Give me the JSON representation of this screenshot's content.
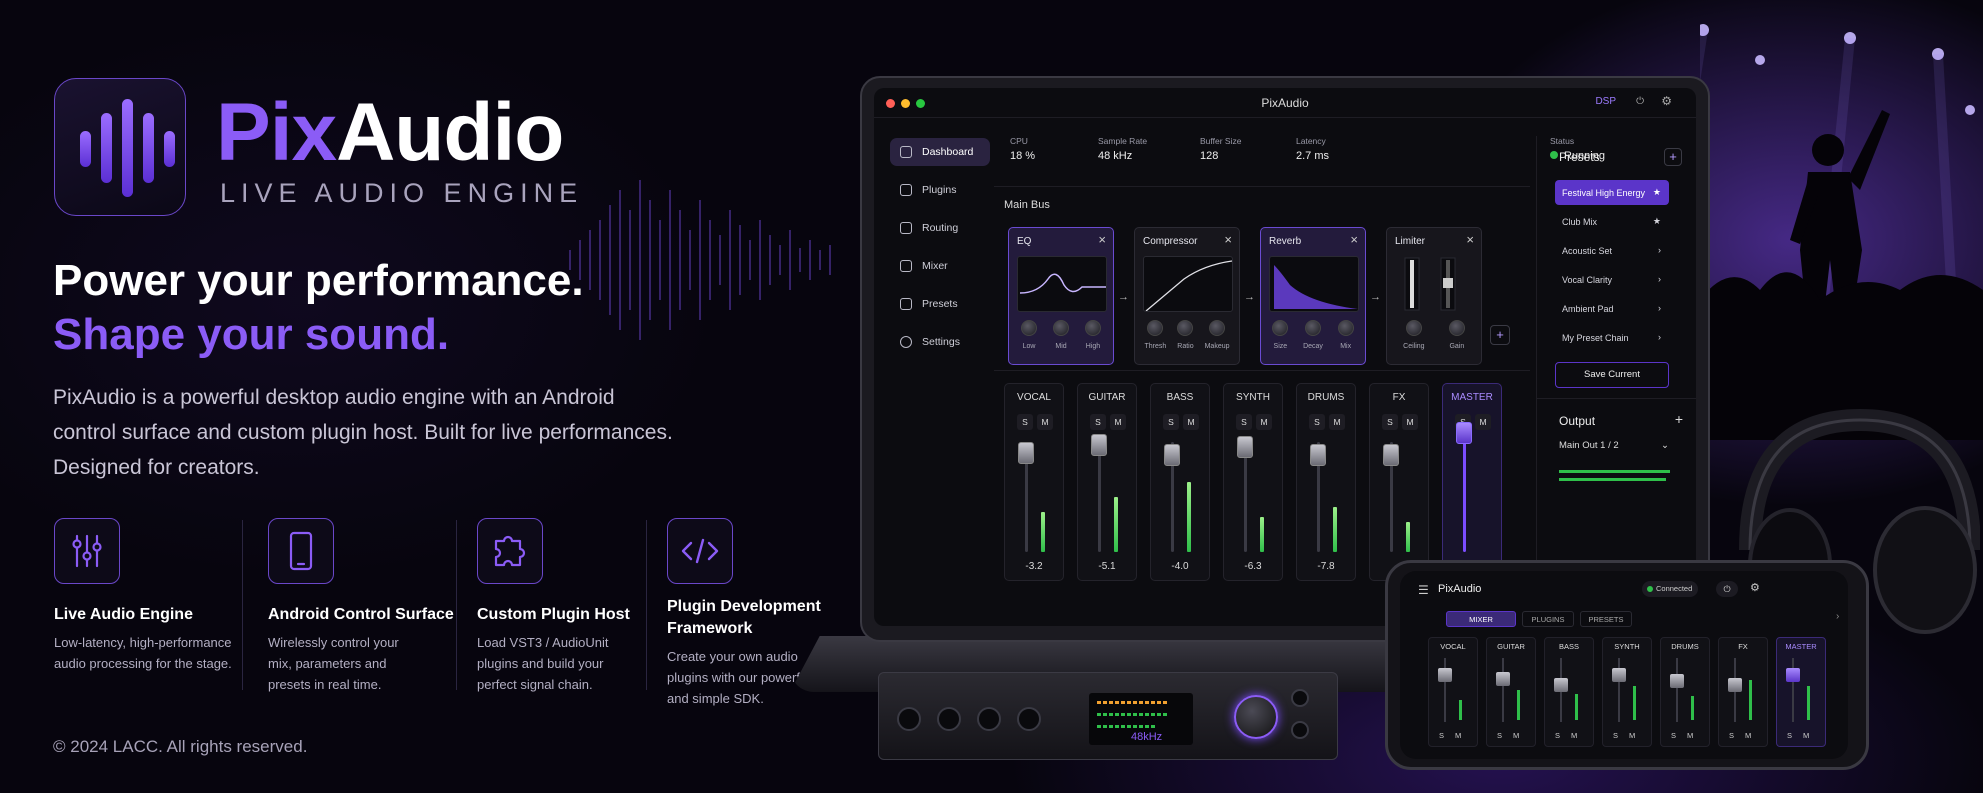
{
  "brand": {
    "name_a": "Pix",
    "name_b": "Audio",
    "tagline": "LIVE AUDIO ENGINE"
  },
  "hero": {
    "line1": "Power your performance.",
    "line2": "Shape your sound.",
    "description": "PixAudio is a powerful desktop audio engine with an Android control surface and custom plugin host. Built for live performances. Designed for creators."
  },
  "features": [
    {
      "icon": "sliders-icon",
      "title": "Live Audio Engine",
      "desc": "Low-latency, high-performance audio processing for the stage."
    },
    {
      "icon": "smartphone-icon",
      "title": "Android Control Surface",
      "desc": "Wirelessly control your mix, parameters and presets in real time."
    },
    {
      "icon": "puzzle-icon",
      "title": "Custom Plugin Host",
      "desc": "Load VST3 / AudioUnit plugins and build your perfect signal chain."
    },
    {
      "icon": "code-icon",
      "title": "Plugin Development Framework",
      "desc": "Create your own audio plugins with our powerful and simple SDK."
    }
  ],
  "footer": {
    "copyright": "© 2024 LACC. All rights reserved."
  },
  "app": {
    "title": "PixAudio",
    "dsp": "DSP",
    "sidebar": [
      {
        "label": "Dashboard",
        "icon": "dashboard-icon",
        "active": true
      },
      {
        "label": "Plugins",
        "icon": "plugin-icon"
      },
      {
        "label": "Routing",
        "icon": "routing-icon"
      },
      {
        "label": "Mixer",
        "icon": "mixer-icon"
      },
      {
        "label": "Presets",
        "icon": "preset-icon"
      },
      {
        "label": "Settings",
        "icon": "gear-icon"
      }
    ],
    "stats": [
      {
        "label": "CPU",
        "value": "18 %"
      },
      {
        "label": "Sample Rate",
        "value": "48 kHz"
      },
      {
        "label": "Buffer Size",
        "value": "128"
      },
      {
        "label": "Latency",
        "value": "2.7 ms"
      }
    ],
    "status": {
      "label": "Status",
      "value": "Running"
    },
    "main_bus": {
      "title": "Main Bus",
      "plugins": [
        {
          "name": "EQ",
          "knobs": [
            "Low",
            "Mid",
            "High"
          ]
        },
        {
          "name": "Compressor",
          "knobs": [
            "Thresh",
            "Ratio",
            "Makeup"
          ]
        },
        {
          "name": "Reverb",
          "knobs": [
            "Size",
            "Decay",
            "Mix"
          ]
        },
        {
          "name": "Limiter",
          "knobs": [
            "Ceiling",
            "Gain"
          ]
        }
      ]
    },
    "presets": {
      "title": "Presets",
      "items": [
        "Festival High Energy",
        "Club Mix",
        "Acoustic Set",
        "Vocal Clarity",
        "Ambient Pad",
        "My Preset Chain"
      ],
      "save_label": "Save Current"
    },
    "output": {
      "title": "Output",
      "selected": "Main Out 1 / 2"
    },
    "mixer": {
      "solo": "S",
      "mute": "M",
      "channels": [
        {
          "name": "VOCAL",
          "value": "-3.2"
        },
        {
          "name": "GUITAR",
          "value": "-5.1"
        },
        {
          "name": "BASS",
          "value": "-4.0"
        },
        {
          "name": "SYNTH",
          "value": "-6.3"
        },
        {
          "name": "DRUMS",
          "value": "-7.8"
        },
        {
          "name": "FX",
          "value": ""
        },
        {
          "name": "MASTER",
          "value": ""
        }
      ]
    }
  },
  "phone": {
    "title": "PixAudio",
    "connected": "Connected",
    "tabs": [
      "MIXER",
      "PLUGINS",
      "PRESETS"
    ],
    "channels": [
      "VOCAL",
      "GUITAR",
      "BASS",
      "SYNTH",
      "DRUMS",
      "FX",
      "MASTER"
    ]
  },
  "interface": {
    "sample_rate": "48kHz"
  },
  "colors": {
    "accent": "#8b5cf6",
    "meter": "#2fbf4a"
  }
}
